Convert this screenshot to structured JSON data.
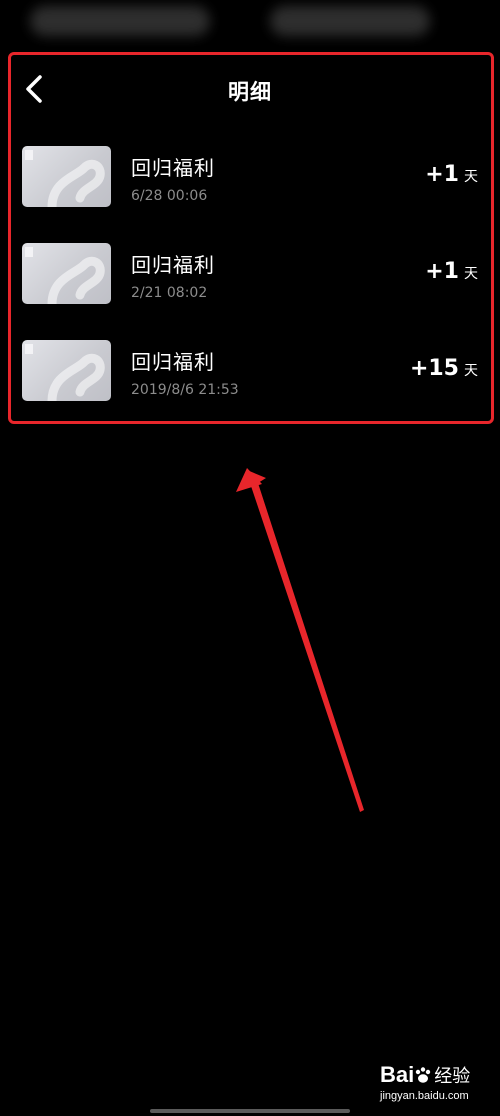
{
  "header": {
    "title": "明细"
  },
  "records": [
    {
      "title": "回归福利",
      "time": "6/28 00:06",
      "amount": "+1",
      "unit": "天"
    },
    {
      "title": "回归福利",
      "time": "2/21 08:02",
      "amount": "+1",
      "unit": "天"
    },
    {
      "title": "回归福利",
      "time": "2019/8/6 21:53",
      "amount": "+15",
      "unit": "天"
    }
  ],
  "watermark": {
    "brand_left": "Bai",
    "brand_right": "经验",
    "url": "jingyan.baidu.com"
  },
  "colors": {
    "background": "#000000",
    "annotation_red": "#e8262b",
    "subtext_gray": "#8c8c8c"
  }
}
